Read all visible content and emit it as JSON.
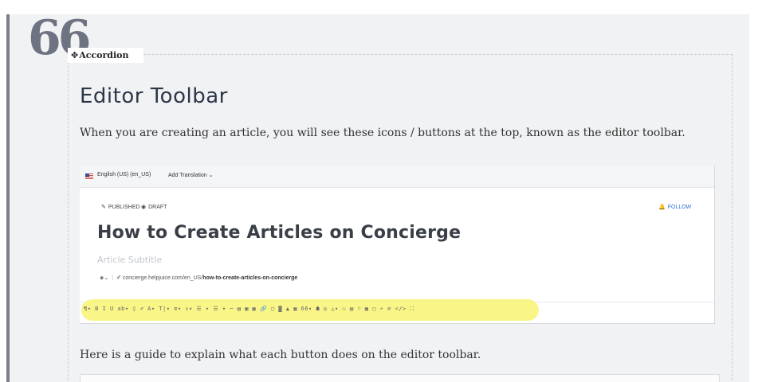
{
  "quote": {
    "mark": "66"
  },
  "accordion": {
    "tag_icon": "move-cross-icon",
    "tag_label": "Accordion"
  },
  "content": {
    "heading": "Editor Toolbar",
    "intro": "When you are creating an article, you will see these icons / buttons at the top, known as the editor toolbar.",
    "outro": "Here is a guide to explain what each button does on the editor toolbar."
  },
  "screenshot": {
    "language": "English (US) (en_US)",
    "add_translation": "Add Translation",
    "status_published": "PUBLISHED",
    "status_draft": "DRAFT",
    "follow": "FOLLOW",
    "article_title": "How to Create Articles on Concierge",
    "article_subtitle": "Article Subtitle",
    "url_base": "concierge.helpjuice.com/en_US/",
    "url_slug": "how-to-create-articles-on-concierge",
    "toolbar_icons": "¶▾ B I U ab▾ ◊ ✐ A▾ T|▾ ≡▾ ↕▾ ☰ ▾ ☰ ▾ ─ ▤ ▣ ▦ 🔗 ▢ ◙ ▲ ▦ 66▾ ☗ ◎ △▾ ⚇ ▤ ⚐ ▦ ▢ ↶ ⌀ </> ⛶"
  },
  "colors": {
    "panel": "#f1f2f4",
    "quote_bar": "#7a7f89",
    "highlight": "#f8f47a",
    "link_blue": "#2b6fd6",
    "heading": "#2d3748"
  }
}
